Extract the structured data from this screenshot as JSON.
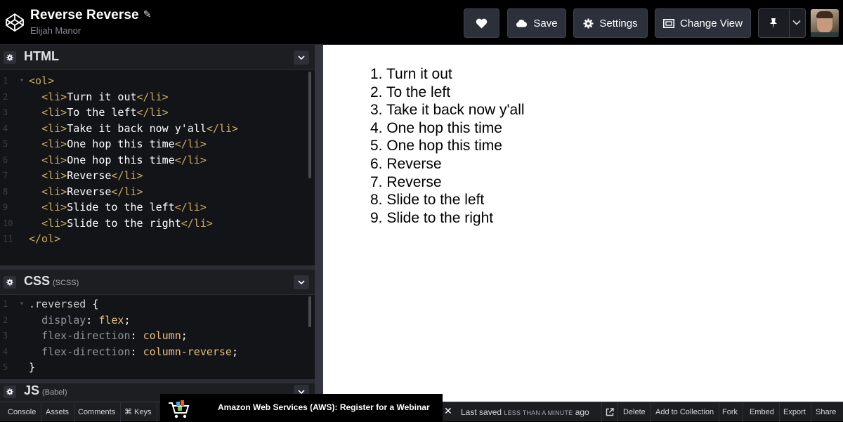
{
  "header": {
    "title": "Reverse Reverse",
    "author": "Elijah Manor",
    "buttons": {
      "save": "Save",
      "settings": "Settings",
      "change_view": "Change View"
    }
  },
  "panes": {
    "html": {
      "title": "HTML"
    },
    "css": {
      "title": "CSS",
      "subtitle": "(SCSS)"
    },
    "js": {
      "title": "JS",
      "subtitle": "(Babel)"
    }
  },
  "html_code": {
    "line_numbers": [
      "1",
      "2",
      "3",
      "4",
      "5",
      "6",
      "7",
      "8",
      "9",
      "10",
      "11"
    ],
    "open_tag": "<ol>",
    "close_tag": "</ol>",
    "li_open": "<li>",
    "li_close": "</li>",
    "items": [
      "Turn it out",
      "To the left",
      "Take it back now y'all",
      "One hop this time",
      "One hop this time",
      "Reverse",
      "Reverse",
      "Slide to the left",
      "Slide to the right"
    ]
  },
  "css_code": {
    "line_numbers": [
      "1",
      "2",
      "3",
      "4",
      "5"
    ],
    "selector": ".reversed",
    "open_brace": "{",
    "close_brace": "}",
    "declarations": [
      {
        "prop": "display",
        "value": "flex"
      },
      {
        "prop": "flex-direction",
        "value": "column"
      },
      {
        "prop": "flex-direction",
        "value": "column-reverse"
      }
    ]
  },
  "preview": {
    "items": [
      "1. Turn it out",
      "2. To the left",
      "3. Take it back now y'all",
      "4. One hop this time",
      "5. One hop this time",
      "6. Reverse",
      "7. Reverse",
      "8. Slide to the left",
      "9. Slide to the right"
    ]
  },
  "footer": {
    "console": "Console",
    "assets": "Assets",
    "comments": "Comments",
    "keys": "⌘ Keys",
    "ad_text": "Amazon Web Services (AWS): Register for a Webinar",
    "close": "✕",
    "last_saved_prefix": "Last saved",
    "last_saved_time": "LESS THAN A MINUTE",
    "last_saved_suffix": "ago",
    "delete": "Delete",
    "add_to_collection": "Add to Collection",
    "fork": "Fork",
    "embed": "Embed",
    "export": "Export",
    "share": "Share"
  },
  "colors": {
    "editor_bg": "#131417",
    "chrome_bg": "#1d1e22",
    "tag": "#c9ae5f",
    "value": "#e5c07b"
  }
}
